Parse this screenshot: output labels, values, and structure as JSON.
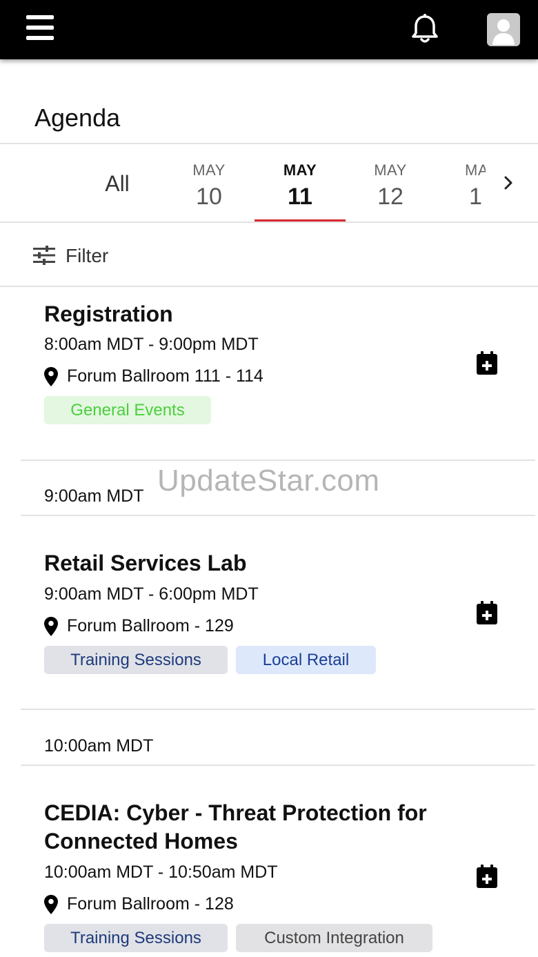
{
  "header": {
    "menu_icon": "hamburger-menu-icon",
    "bell_icon": "notification-bell-icon",
    "avatar_icon": "user-avatar-icon"
  },
  "page": {
    "title": "Agenda"
  },
  "tabs": {
    "all_label": "All",
    "dates": [
      {
        "month": "MAY",
        "day": "10"
      },
      {
        "month": "MAY",
        "day": "11"
      },
      {
        "month": "MAY",
        "day": "12"
      },
      {
        "month": "MA",
        "day": "1"
      }
    ],
    "active_index": 1,
    "next_icon": "chevron-right-icon",
    "active_color": "#d9262c"
  },
  "filter": {
    "label": "Filter",
    "icon": "sliders-icon"
  },
  "events": [
    {
      "title": "Registration",
      "time": "8:00am MDT - 9:00pm MDT",
      "location": "Forum Ballroom 111 - 114",
      "tags": [
        "General Events"
      ]
    },
    {
      "title": "Retail Services Lab",
      "time": "9:00am MDT - 6:00pm MDT",
      "location": "Forum Ballroom - 129",
      "tags": [
        "Training Sessions",
        "Local Retail"
      ]
    },
    {
      "title_line1": "CEDIA: Cyber - Threat Protection for",
      "title_line2": "Connected Homes",
      "time": "10:00am MDT - 10:50am MDT",
      "location": "Forum Ballroom - 128",
      "tags": [
        "Training Sessions",
        "Custom Integration"
      ]
    }
  ],
  "time_headers": [
    "9:00am MDT",
    "10:00am MDT"
  ],
  "watermark": "UpdateStar.com"
}
